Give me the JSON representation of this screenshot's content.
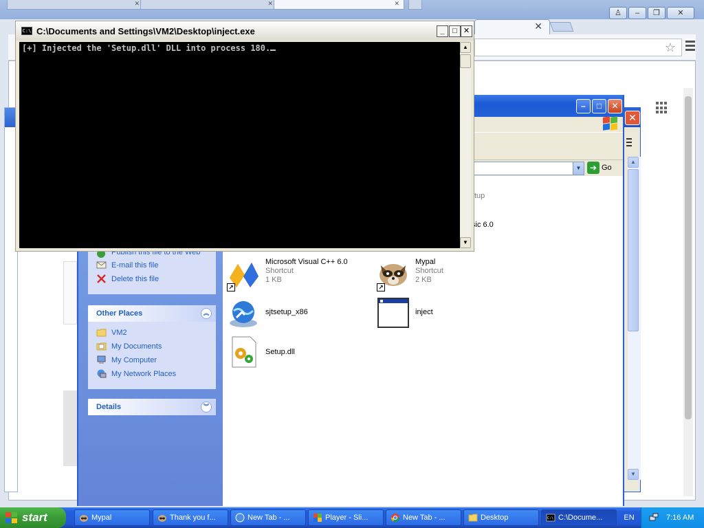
{
  "console": {
    "title": "C:\\Documents and Settings\\VM2\\Desktop\\inject.exe",
    "output": "[+] Injected the 'Setup.dll' DLL into process 180.",
    "icon_label": "C:\\"
  },
  "explorer": {
    "address_go_label": "Go",
    "tasks": {
      "file_tasks": [
        {
          "label": "Publish this file to the Web",
          "icon": "globe-icon"
        },
        {
          "label": "E-mail this file",
          "icon": "email-icon"
        },
        {
          "label": "Delete this file",
          "icon": "delete-x-icon"
        }
      ],
      "other_places_title": "Other Places",
      "other_places": [
        {
          "label": "VM2",
          "icon": "folder-icon"
        },
        {
          "label": "My Documents",
          "icon": "documents-icon"
        },
        {
          "label": "My Computer",
          "icon": "computer-icon"
        },
        {
          "label": "My Network Places",
          "icon": "network-icon"
        }
      ],
      "details_title": "Details"
    },
    "files": [
      {
        "name": "Microsoft Visual C++ 6.0",
        "type": "Shortcut",
        "size": "1 KB"
      },
      {
        "name": "Mypal",
        "type": "Shortcut",
        "size": "2 KB"
      },
      {
        "name": "sjtsetup_x86"
      },
      {
        "name": "inject"
      },
      {
        "name": "Setup.dll"
      }
    ],
    "partial_labels": {
      "top": "tup",
      "second": "sic 6.0"
    }
  },
  "taskbar": {
    "start_label": "start",
    "buttons": [
      {
        "label": "Mypal",
        "icon": "mypal-icon"
      },
      {
        "label": "Thank you f...",
        "icon": "mypal-icon"
      },
      {
        "label": "New Tab - ...",
        "icon": "browser-globe-icon"
      },
      {
        "label": "Player - Sli...",
        "icon": "player-icon"
      },
      {
        "label": "New Tab - ...",
        "icon": "chrome-icon"
      },
      {
        "label": "Desktop",
        "icon": "folder-icon"
      },
      {
        "label": "C:\\Docume...",
        "icon": "cmd-icon"
      }
    ],
    "language": "EN",
    "clock": "7:16 AM"
  },
  "colors": {
    "xp_blue": "#2a5fd0",
    "task_link": "#215dc6",
    "taskbar": "#245edb",
    "start_green": "#3a9b37"
  }
}
